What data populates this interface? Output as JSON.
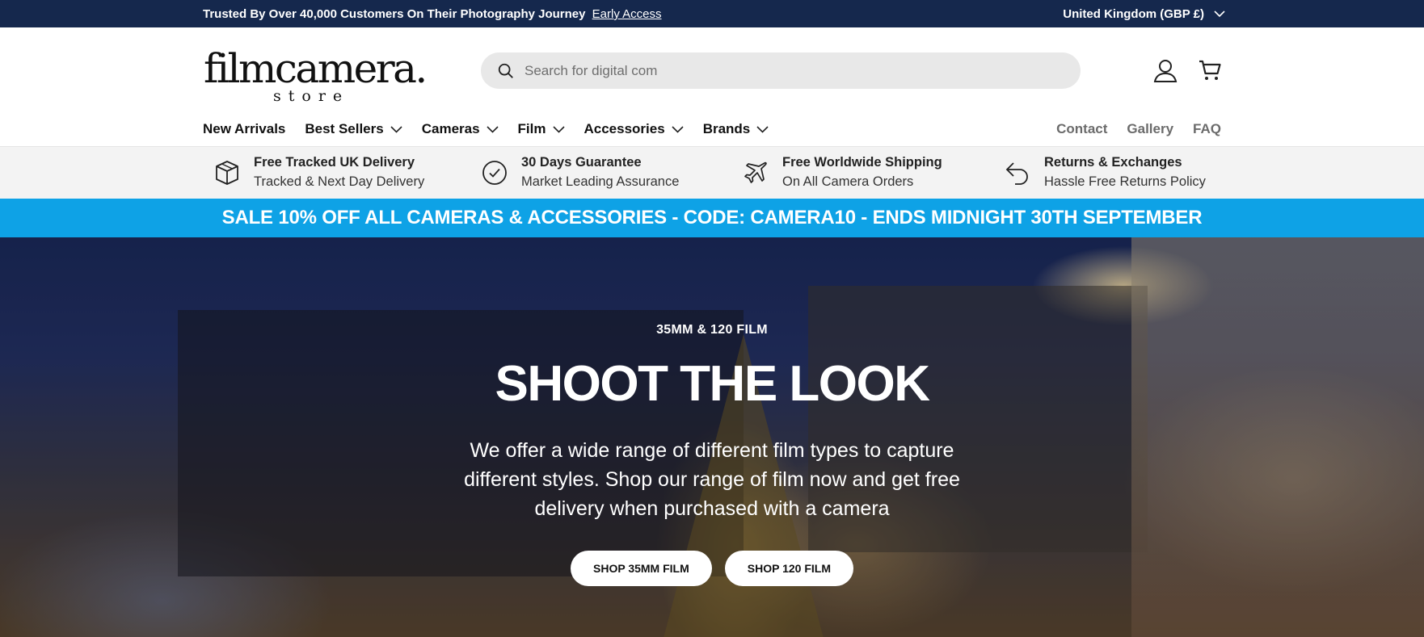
{
  "announcement": {
    "text": "Trusted By Over 40,000 Customers On Their Photography Journey",
    "link": "Early Access",
    "region": "United Kingdom (GBP £)"
  },
  "header": {
    "logo_main": "filmcamera.",
    "logo_sub": "store",
    "search_placeholder": "Search for digital com",
    "icons": [
      "search-icon",
      "account-icon",
      "cart-icon"
    ]
  },
  "nav": {
    "items": [
      {
        "label": "New Arrivals",
        "dropdown": false
      },
      {
        "label": "Best Sellers",
        "dropdown": true
      },
      {
        "label": "Cameras",
        "dropdown": true
      },
      {
        "label": "Film",
        "dropdown": true
      },
      {
        "label": "Accessories",
        "dropdown": true
      },
      {
        "label": "Brands",
        "dropdown": true
      }
    ],
    "right": [
      "Contact",
      "Gallery",
      "FAQ"
    ]
  },
  "usps": [
    {
      "icon": "box-icon",
      "title": "Free Tracked UK Delivery",
      "subtitle": "Tracked & Next Day Delivery"
    },
    {
      "icon": "check-circle-icon",
      "title": "30 Days Guarantee",
      "subtitle": "Market Leading Assurance"
    },
    {
      "icon": "plane-icon",
      "title": "Free Worldwide Shipping",
      "subtitle": "On All Camera Orders"
    },
    {
      "icon": "return-arrow-icon",
      "title": "Returns & Exchanges",
      "subtitle": "Hassle Free Returns Policy"
    }
  ],
  "sale_banner": "SALE 10% OFF ALL CAMERAS & ACCESSORIES - CODE: CAMERA10 - ENDS MIDNIGHT 30TH SEPTEMBER",
  "hero": {
    "eyebrow": "35MM & 120 FILM",
    "title": "SHOOT THE LOOK",
    "description": "We offer a wide range of different film types to capture different styles. Shop our range of film now and get free delivery when purchased with a camera",
    "buttons": [
      "SHOP 35MM FILM",
      "SHOP 120 FILM"
    ]
  },
  "colors": {
    "announcement_bg": "#15284d",
    "sale_bg": "#0ea2e6",
    "usp_bg": "#f3f3f3",
    "search_bg": "#e8e8e8"
  }
}
